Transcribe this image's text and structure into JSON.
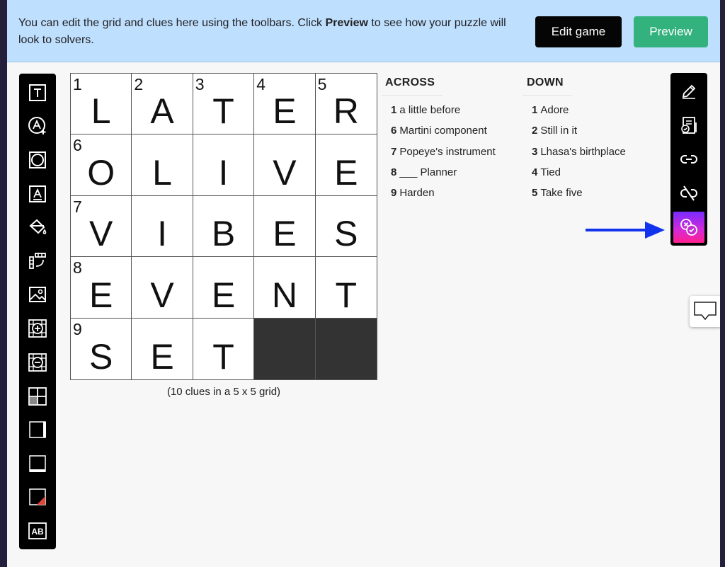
{
  "banner": {
    "text_before": "You can edit the grid and clues here using the toolbars. Click ",
    "text_bold": "Preview",
    "text_after": " to see how your puzzle will look to solvers.",
    "edit_label": "Edit game",
    "preview_label": "Preview"
  },
  "left_toolbar": {
    "icons": [
      "text-box-icon",
      "add-circle-letter-icon",
      "circle-shape-icon",
      "letter-box-icon",
      "paint-bucket-icon",
      "row-column-icon",
      "image-icon",
      "zoom-in-grid-icon",
      "zoom-out-grid-icon",
      "grid-layout-icon",
      "right-border-icon",
      "bottom-border-icon",
      "corner-fill-icon",
      "ab-text-icon"
    ]
  },
  "grid": {
    "rows": 5,
    "cols": 5,
    "cells": [
      [
        {
          "n": "1",
          "l": "L"
        },
        {
          "n": "2",
          "l": "A"
        },
        {
          "n": "3",
          "l": "T"
        },
        {
          "n": "4",
          "l": "E"
        },
        {
          "n": "5",
          "l": "R"
        }
      ],
      [
        {
          "n": "6",
          "l": "O"
        },
        {
          "n": "",
          "l": "L"
        },
        {
          "n": "",
          "l": "I"
        },
        {
          "n": "",
          "l": "V"
        },
        {
          "n": "",
          "l": "E"
        }
      ],
      [
        {
          "n": "7",
          "l": "V"
        },
        {
          "n": "",
          "l": "I"
        },
        {
          "n": "",
          "l": "B"
        },
        {
          "n": "",
          "l": "E"
        },
        {
          "n": "",
          "l": "S"
        }
      ],
      [
        {
          "n": "8",
          "l": "E"
        },
        {
          "n": "",
          "l": "V"
        },
        {
          "n": "",
          "l": "E"
        },
        {
          "n": "",
          "l": "N"
        },
        {
          "n": "",
          "l": "T"
        }
      ],
      [
        {
          "n": "9",
          "l": "S"
        },
        {
          "n": "",
          "l": "E"
        },
        {
          "n": "",
          "l": "T"
        },
        {
          "black": true
        },
        {
          "black": true
        }
      ]
    ],
    "caption": "(10 clues in a 5 x 5 grid)"
  },
  "across": {
    "heading": "ACROSS",
    "clues": [
      {
        "num": "1",
        "text": "a little before"
      },
      {
        "num": "6",
        "text": "Martini component"
      },
      {
        "num": "7",
        "text": "Popeye's instrument"
      },
      {
        "num": "8",
        "text": "___ Planner"
      },
      {
        "num": "9",
        "text": "Harden"
      }
    ]
  },
  "down": {
    "heading": "DOWN",
    "clues": [
      {
        "num": "1",
        "text": "Adore"
      },
      {
        "num": "2",
        "text": "Still in it"
      },
      {
        "num": "3",
        "text": "Lhasa's birthplace"
      },
      {
        "num": "4",
        "text": "Tied"
      },
      {
        "num": "5",
        "text": "Take five"
      }
    ]
  },
  "right_toolbar": {
    "icons": [
      "pencil-icon",
      "checklist-icon",
      "link-icon",
      "unlink-icon",
      "check-answers-icon"
    ],
    "active_index": 4,
    "active_gradient": [
      "#7a2cff",
      "#ff1f8e"
    ]
  },
  "colors": {
    "banner_bg": "#bfdfff",
    "edit_button": "#050505",
    "preview_button": "#33b27e",
    "arrow": "#1133ee",
    "black_cell": "#333333"
  }
}
